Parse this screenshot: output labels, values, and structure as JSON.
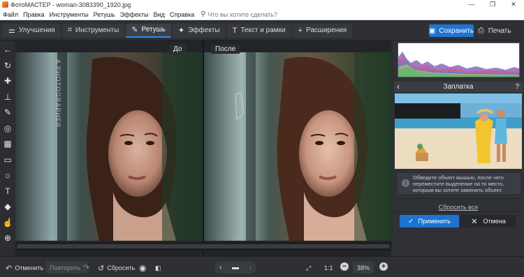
{
  "titlebar": {
    "title": "ФотоМАСТЕР - woman-3083390_1920.jpg",
    "minimize": "—",
    "maximize": "❐",
    "close": "✕"
  },
  "menu": {
    "items": [
      "Файл",
      "Правка",
      "Инструменты",
      "Ретушь",
      "Эффекты",
      "Вид",
      "Справка"
    ],
    "search_placeholder": "Что вы хотите сделать?"
  },
  "toolbar": {
    "tabs": [
      {
        "label": "Улучшения",
        "icon": "sliders-icon",
        "glyph": "⚌",
        "active": false
      },
      {
        "label": "Инструменты",
        "icon": "crop-icon",
        "glyph": "⌗",
        "active": false
      },
      {
        "label": "Ретушь",
        "icon": "brush-icon",
        "glyph": "✎",
        "active": true
      },
      {
        "label": "Эффекты",
        "icon": "magic-wand-icon",
        "glyph": "✦",
        "active": false
      },
      {
        "label": "Текст и рамки",
        "icon": "text-icon",
        "glyph": "T",
        "active": false
      },
      {
        "label": "Расширения",
        "icon": "plus-icon",
        "glyph": "+",
        "active": false
      }
    ],
    "save_label": "Сохранить",
    "print_label": "Печать"
  },
  "left_tools": [
    {
      "name": "back-arrow-icon",
      "glyph": "←"
    },
    {
      "name": "rotate-icon",
      "glyph": "↻"
    },
    {
      "name": "healing-patch-icon",
      "glyph": "✚"
    },
    {
      "name": "stamp-icon",
      "glyph": "⊥"
    },
    {
      "name": "brush-icon",
      "glyph": "✎"
    },
    {
      "name": "radial-filter-icon",
      "glyph": "◎"
    },
    {
      "name": "gradient-filter-icon",
      "glyph": "▦"
    },
    {
      "name": "vignette-icon",
      "glyph": "▭"
    },
    {
      "name": "light-icon",
      "glyph": "☼"
    },
    {
      "name": "text-tool-icon",
      "glyph": "T"
    },
    {
      "name": "fill-icon",
      "glyph": "◆"
    },
    {
      "name": "liquify-icon",
      "glyph": "☝"
    },
    {
      "name": "compass-icon",
      "glyph": "⊕"
    }
  ],
  "canvas": {
    "before_label": "До",
    "after_label": "После",
    "watermark_text": "A PHOTOGRAPHER"
  },
  "panel": {
    "title": "Заплатка",
    "back_glyph": "‹",
    "help": "?",
    "hint": "Обведите объект мышью, после чего переместите выделение на то место, которым вы хотите заменить объект.",
    "reset_all": "Сбросить все",
    "apply_label": "Применить",
    "cancel_label": "Отмена"
  },
  "bottom": {
    "undo_label": "Отменить",
    "redo_label": "Повторить",
    "reset_label": "Сбросить",
    "one_to_one": "1:1",
    "zoom": "38%"
  },
  "colors": {
    "accent": "#1f74d1",
    "background": "#2b2d31"
  }
}
